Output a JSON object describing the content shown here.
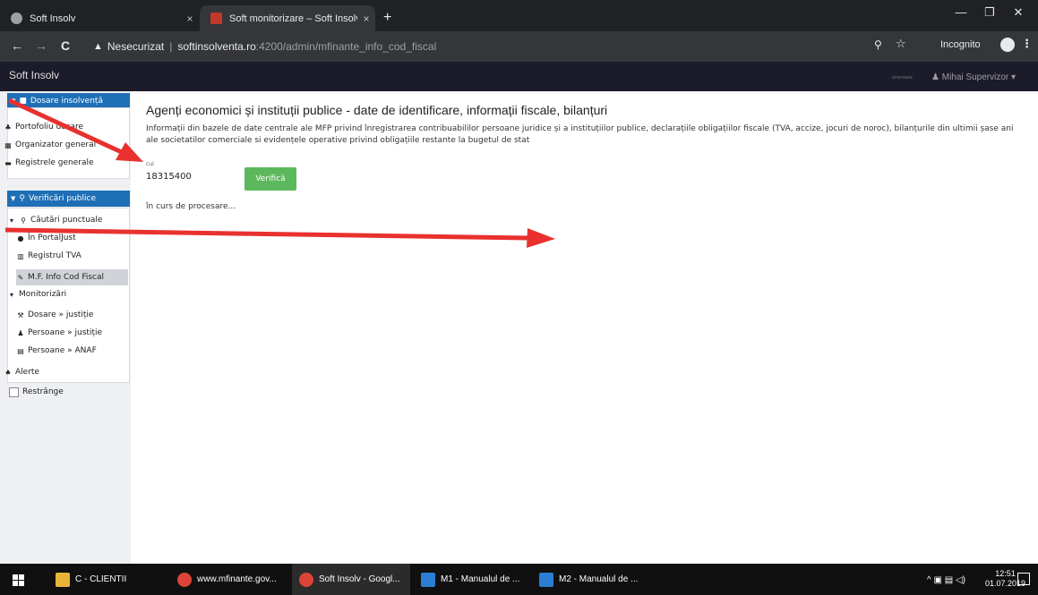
{
  "browser": {
    "tabs": [
      {
        "title": "Soft Insolv",
        "close": "×"
      },
      {
        "title": "Soft monitorizare – Soft Insolvent",
        "close": "×"
      }
    ],
    "new_tab": "+",
    "window_controls": {
      "minimize": "—",
      "maximize": "❐",
      "close": "✕"
    },
    "nav": {
      "back": "←",
      "forward": "→",
      "reload": "C"
    },
    "url": {
      "security_label": "Nesecurizat",
      "separator": "|",
      "host": "softinsolventa.ro",
      "path": ":4200/admin/mfinante_info_cod_fiscal"
    },
    "incognito_label": "Incognito"
  },
  "app": {
    "brand": "Soft Insolv",
    "user_name": "Mihai Supervizor",
    "nav_small_text": "orientare"
  },
  "sidebar": {
    "group1": {
      "label": "Dosare insolvență",
      "items": [
        {
          "label": "Portofoliu dosare",
          "icon": "users-icon"
        },
        {
          "label": "Organizator general",
          "icon": "calendar-icon"
        },
        {
          "label": "Registrele generale",
          "icon": "hdd-icon"
        }
      ]
    },
    "group2": {
      "label": "Verificări publice"
    },
    "cautari": {
      "label": "Căutări punctuale",
      "items": [
        {
          "label": "În PortalJust"
        },
        {
          "label": "Registrul TVA"
        },
        {
          "label": "M.F. Info Cod Fiscal"
        }
      ]
    },
    "monitorizari": {
      "label": "Monitorizări",
      "items": [
        {
          "label": "Dosare » justiție"
        },
        {
          "label": "Persoane » justiție"
        },
        {
          "label": "Persoane » ANAF"
        }
      ]
    },
    "alerte": "Alerte",
    "restrange": "Restrânge"
  },
  "main": {
    "title": "Agenți economici și instituții publice - date de identificare, informații fiscale, bilanțuri",
    "description": "Informații din bazele de date centrale ale MFP privind înregistrarea contribuabililor persoane juridice și a instituțiilor publice, declarațiile obligațiilor fiscale (TVA, accize, jocuri de noroc), bilanțurile din ultimii șase ani ale societatilor comerciale si evidențele operative privind obligațiile restante la bugetul de stat",
    "cui_label": "cui",
    "cui_value": "18315400",
    "verify_button": "Verifică",
    "status": "în curs de procesare..."
  },
  "taskbar": {
    "items": [
      {
        "label": "C - CLIENTII"
      },
      {
        "label": "www.mfinante.gov..."
      },
      {
        "label": "Soft Insolv - Googl..."
      },
      {
        "label": "M1 - Manualul de ..."
      },
      {
        "label": "M2 - Manualul de ..."
      }
    ],
    "time": "12:51",
    "date": "01.07.2019"
  },
  "colors": {
    "sidebar_group": "#1e6fb5",
    "verify_button": "#5cb85c",
    "annotation_arrow": "#e8312f",
    "app_navbar": "#1b1b2a"
  }
}
